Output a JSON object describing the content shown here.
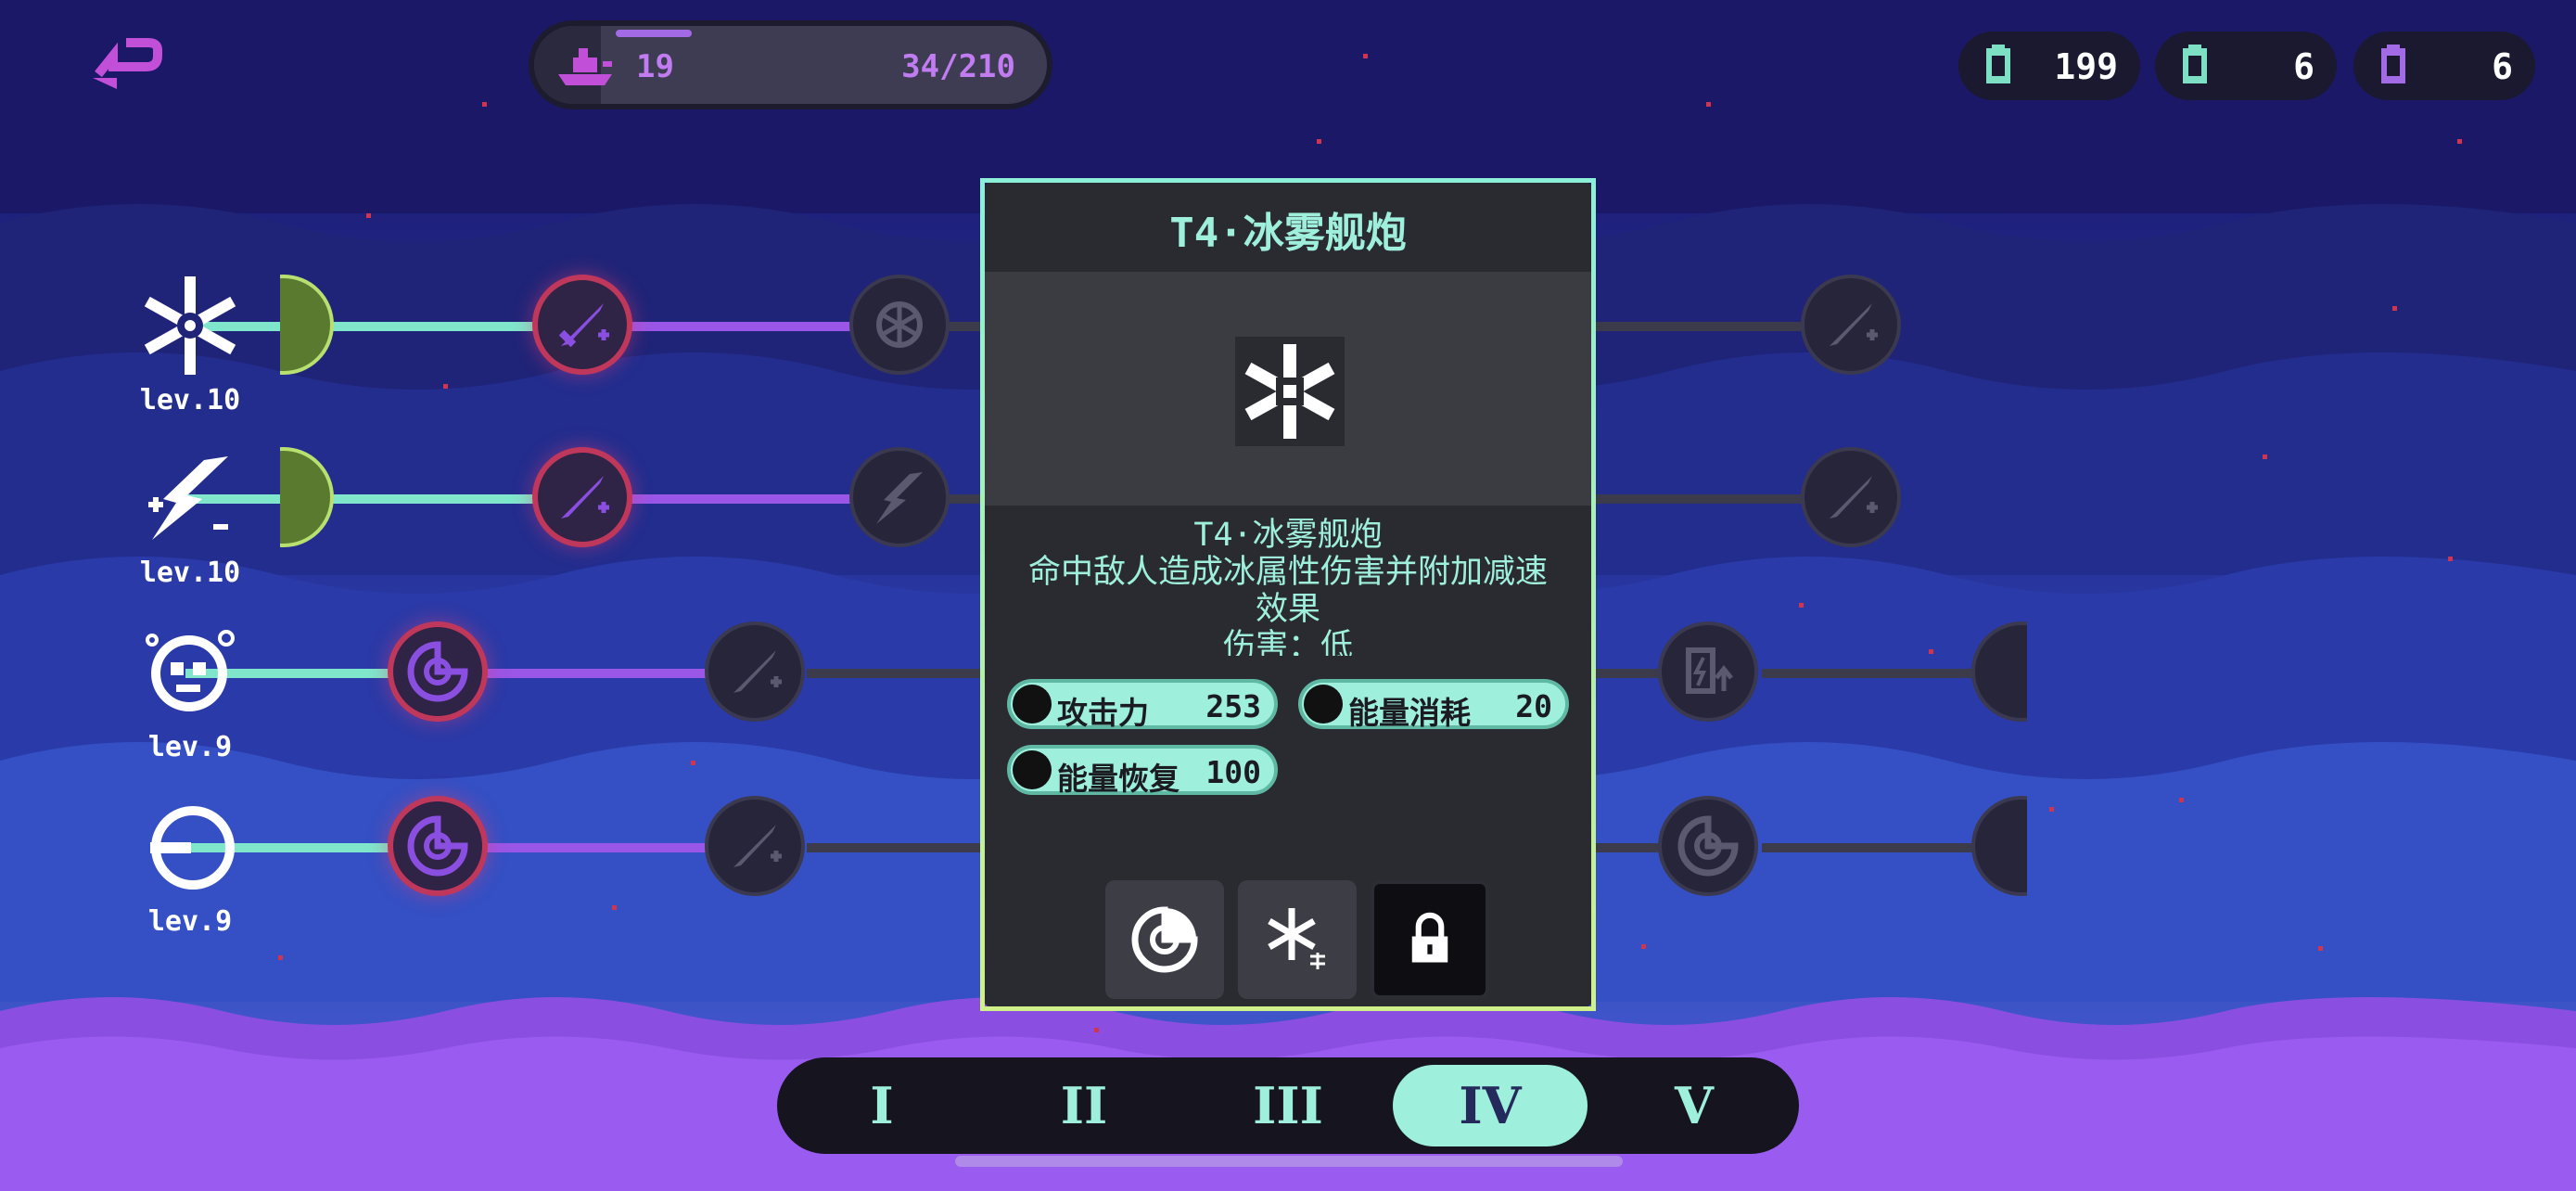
{
  "topbar": {
    "back_icon": "back-arrow-icon",
    "ship": {
      "icon": "ship-icon",
      "level": "19",
      "xp": "34/210",
      "xp_progress": 0.16
    },
    "resources": [
      {
        "icon": "teal-battery-icon",
        "value": "199",
        "color": "#7de0c4"
      },
      {
        "icon": "teal-cell-icon",
        "value": "6",
        "color": "#7de0c4"
      },
      {
        "icon": "purple-cell-icon",
        "value": "6",
        "color": "#a36ae6"
      }
    ]
  },
  "skill_rows": [
    {
      "icon": "snowflake-icon",
      "level": "lev.10"
    },
    {
      "icon": "ice-lightning-icon",
      "level": "lev.10"
    },
    {
      "icon": "skull-cloud-icon",
      "level": "lev.9"
    },
    {
      "icon": "ring-icon",
      "level": "lev.9"
    }
  ],
  "popup": {
    "title": "T4·冰雾舰炮",
    "preview_icon": "large-snowflake-icon",
    "desc_title": "T4·冰雾舰炮",
    "desc_line1": "命中敌人造成冰属性伤害并附加减速",
    "desc_line2": "效果",
    "desc_line3": "伤害：低",
    "stats": [
      {
        "label": "攻击力",
        "value": "253"
      },
      {
        "label": "能量消耗",
        "value": "20"
      },
      {
        "label": "能量恢复",
        "value": "100"
      }
    ],
    "slots": [
      "radar-icon",
      "snowflake-upgrade-icon",
      "lock-icon"
    ]
  },
  "tabs": [
    {
      "label": "I",
      "selected": false
    },
    {
      "label": "II",
      "selected": false
    },
    {
      "label": "III",
      "selected": false
    },
    {
      "label": "IV",
      "selected": true
    },
    {
      "label": "V",
      "selected": false
    }
  ],
  "colors": {
    "accent_teal": "#9ef0dc",
    "accent_purple": "#a36ae6",
    "active_ring": "#c0375c"
  }
}
